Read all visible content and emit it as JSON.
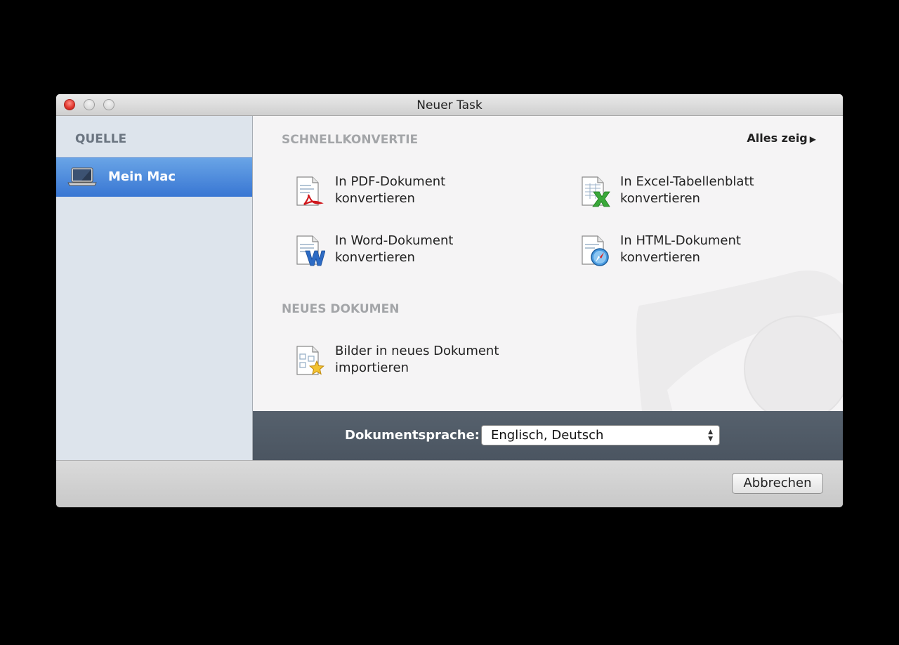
{
  "window": {
    "title": "Neuer Task"
  },
  "sidebar": {
    "header": "QUELLE",
    "items": [
      {
        "label": "Mein Mac",
        "icon": "laptop-icon",
        "selected": true
      }
    ]
  },
  "quick_convert": {
    "header": "SCHNELLKONVERTIE",
    "show_all": "Alles zeig",
    "tasks": [
      {
        "line1": "In PDF-Dokument",
        "line2": "konvertieren",
        "icon": "pdf-document-icon"
      },
      {
        "line1": "In Excel-Tabellenblatt",
        "line2": "konvertieren",
        "icon": "excel-document-icon"
      },
      {
        "line1": "In Word-Dokument",
        "line2": "konvertieren",
        "icon": "word-document-icon"
      },
      {
        "line1": "In HTML-Dokument",
        "line2": "konvertieren",
        "icon": "html-document-icon"
      }
    ]
  },
  "new_document": {
    "header": "NEUES DOKUMEN",
    "tasks": [
      {
        "line1": "Bilder in neues Dokument",
        "line2": "importieren",
        "icon": "import-images-icon"
      }
    ]
  },
  "language": {
    "label": "Dokumentsprache:",
    "value": "Englisch, Deutsch"
  },
  "footer": {
    "cancel": "Abbrechen"
  },
  "colors": {
    "selection": "#3f7fd8",
    "langbar": "#515c68",
    "close": "#e0342b"
  }
}
